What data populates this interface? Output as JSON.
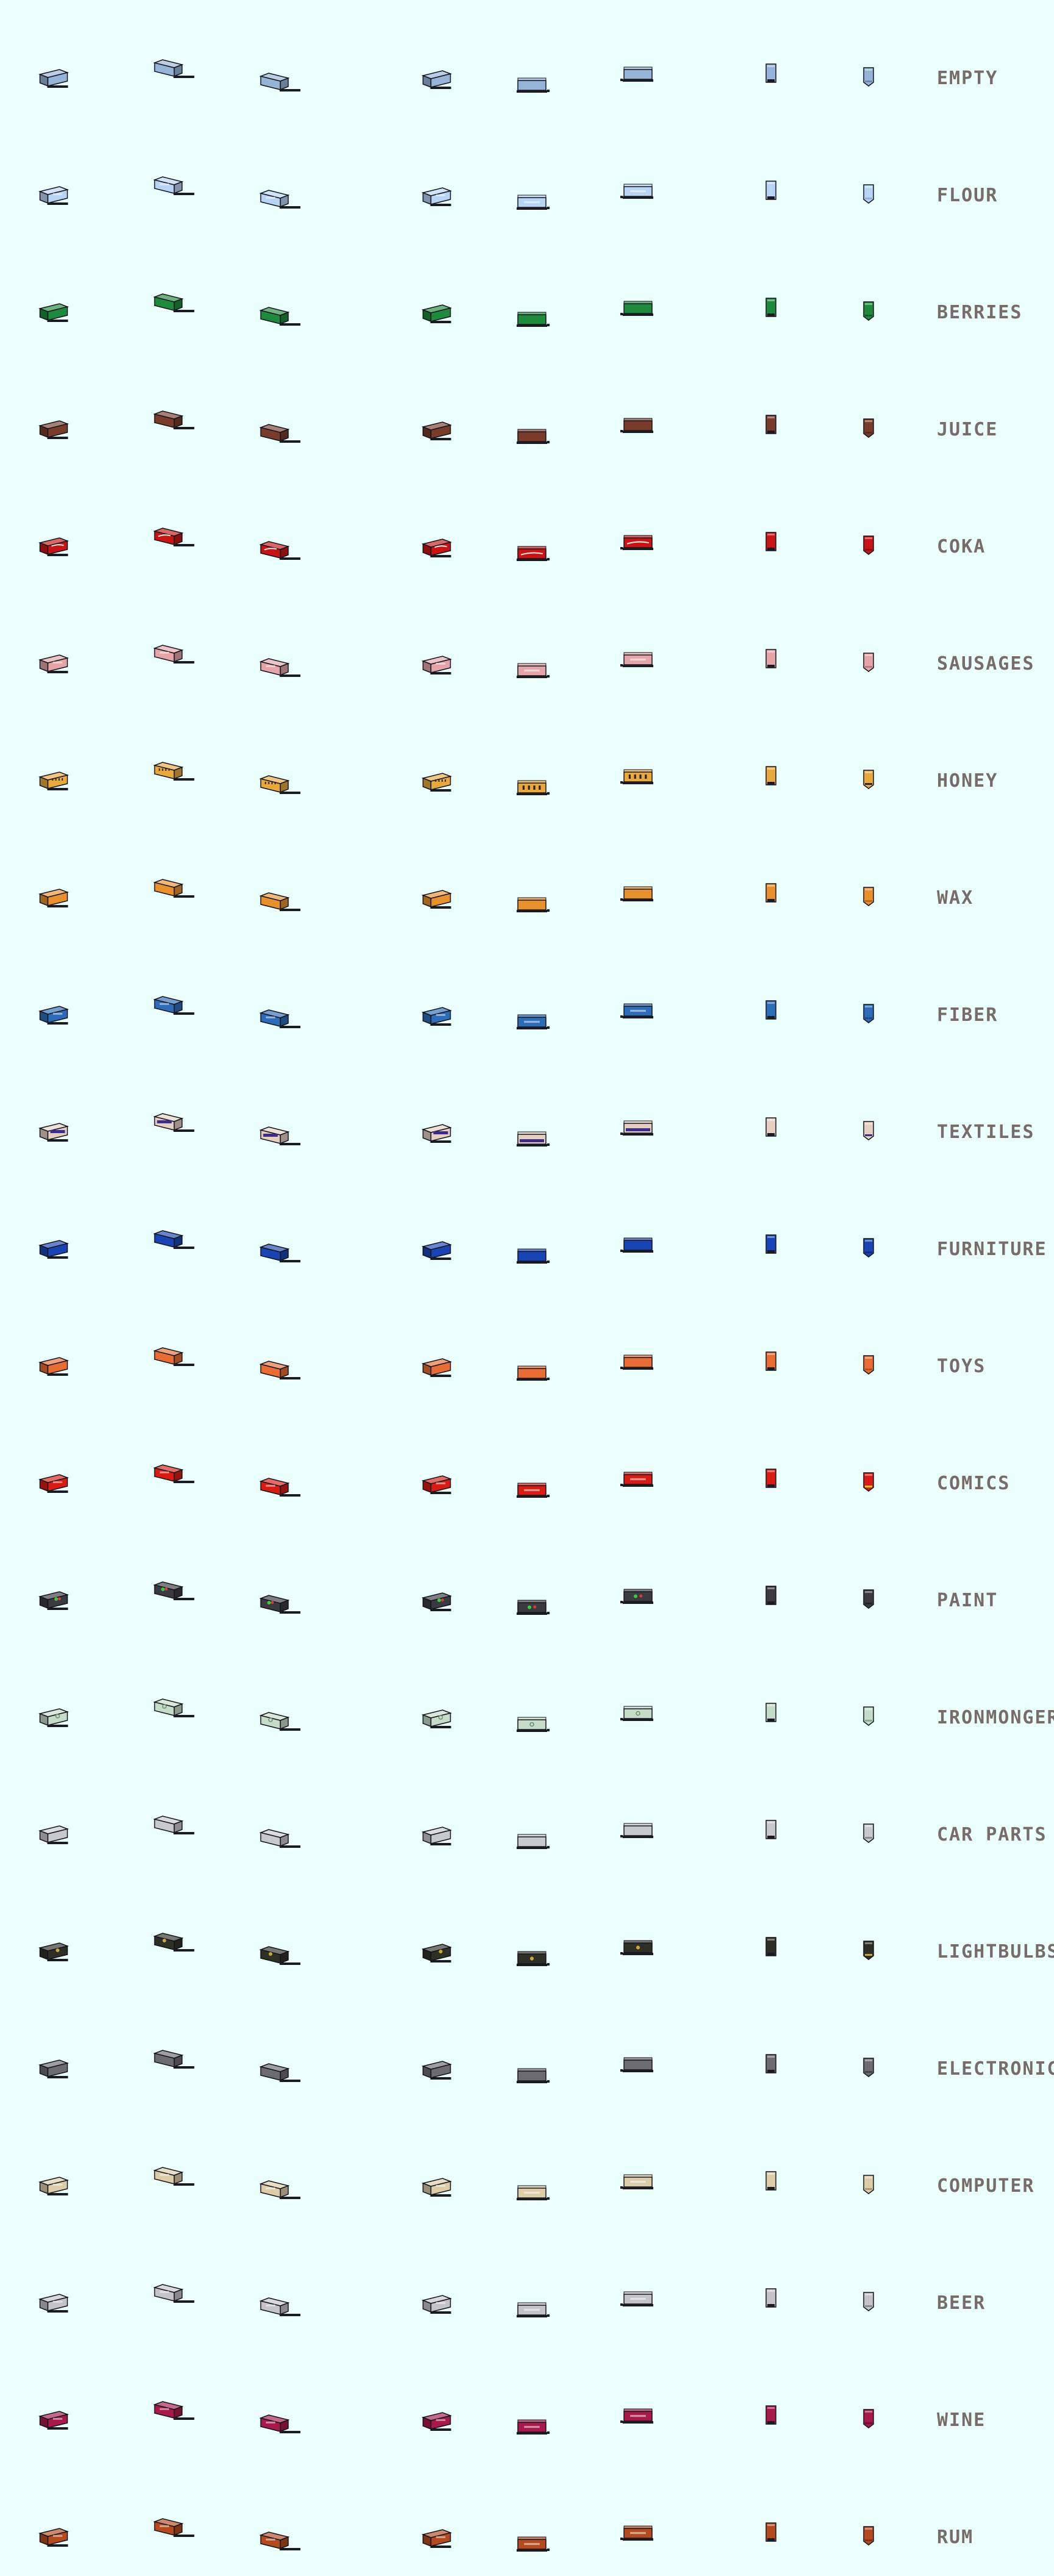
{
  "sheet": {
    "background": "#ebfffd",
    "label_color": "#786c6a"
  },
  "views": [
    "ne",
    "se",
    "sw",
    "nw-raised",
    "e",
    "w",
    "n",
    "s"
  ],
  "rows": [
    {
      "label": "EMPTY",
      "color": "#96b4d8",
      "dark": "#6e88a8",
      "decal": "none"
    },
    {
      "label": "FLOUR",
      "color": "#b8d4f4",
      "dark": "#8eaed2",
      "decal": "text"
    },
    {
      "label": "BERRIES",
      "color": "#1e8a3c",
      "dark": "#14602a",
      "decal": "none"
    },
    {
      "label": "JUICE",
      "color": "#7a3c2a",
      "dark": "#552a1e",
      "decal": "none"
    },
    {
      "label": "COKA",
      "color": "#c81414",
      "dark": "#8a0e0e",
      "decal": "wave"
    },
    {
      "label": "SAUSAGES",
      "color": "#e4a4a8",
      "dark": "#b87a80",
      "decal": "text"
    },
    {
      "label": "HONEY",
      "color": "#e8a83c",
      "dark": "#2e2418",
      "decal": "stripes"
    },
    {
      "label": "WAX",
      "color": "#e8902c",
      "dark": "#b46a1e",
      "decal": "none"
    },
    {
      "label": "FIBER",
      "color": "#2c6cb8",
      "dark": "#1e4c86",
      "decal": "text"
    },
    {
      "label": "TEXTILES",
      "color": "#e4cfc2",
      "dark": "#3c2c8c",
      "decal": "stripe"
    },
    {
      "label": "FURNITURE",
      "color": "#1844b4",
      "dark": "#102e80",
      "decal": "none"
    },
    {
      "label": "TOYS",
      "color": "#e86c34",
      "dark": "#b04e24",
      "decal": "none"
    },
    {
      "label": "COMICS",
      "color": "#d81c14",
      "dark": "#f0c818",
      "decal": "text"
    },
    {
      "label": "PAINT",
      "color": "#3a3a40",
      "dark": "#222226",
      "decal": "splash"
    },
    {
      "label": "IRONMONGERY",
      "color": "#c4dcc8",
      "dark": "#8ca894",
      "decal": "logo"
    },
    {
      "label": "CAR PARTS",
      "color": "#c8c8d0",
      "dark": "#8c8c96",
      "decal": "none"
    },
    {
      "label": "LIGHTBULBS",
      "color": "#2e3026",
      "dark": "#c8a838",
      "decal": "bulb"
    },
    {
      "label": "ELECTRONICS",
      "color": "#6c6c70",
      "dark": "#46464a",
      "decal": "none"
    },
    {
      "label": "COMPUTER",
      "color": "#dccca8",
      "dark": "#a89878",
      "decal": "text"
    },
    {
      "label": "BEER",
      "color": "#c4c4c8",
      "dark": "#8c8c90",
      "decal": "text"
    },
    {
      "label": "WINE",
      "color": "#a81848",
      "dark": "#6e0e30",
      "decal": "text"
    },
    {
      "label": "RUM",
      "color": "#b44a1e",
      "dark": "#7c3214",
      "decal": "text"
    }
  ]
}
